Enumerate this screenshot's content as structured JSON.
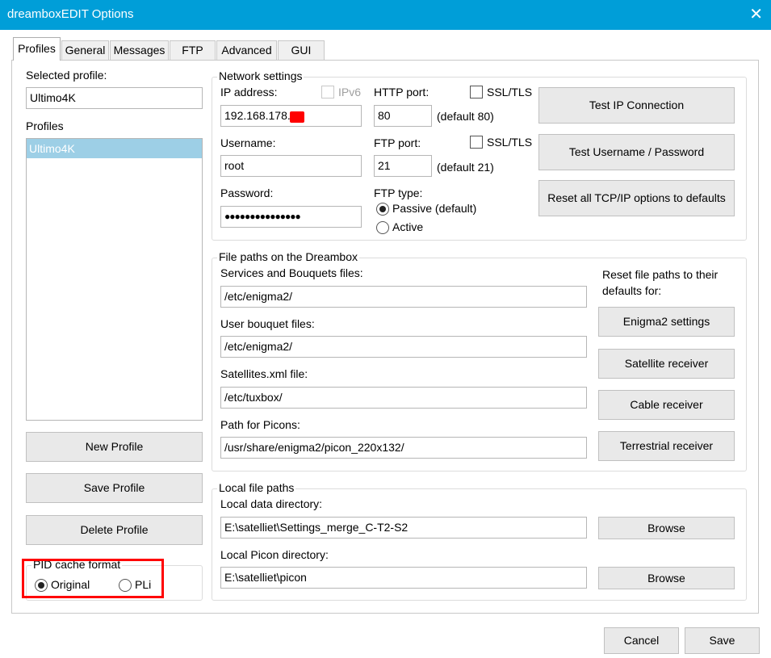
{
  "window": {
    "title": "dreamboxEDIT Options",
    "close_glyph": "✕"
  },
  "tabs": [
    {
      "label": "Profiles",
      "active": true
    },
    {
      "label": "General"
    },
    {
      "label": "Messages"
    },
    {
      "label": "FTP"
    },
    {
      "label": "Advanced"
    },
    {
      "label": "GUI"
    }
  ],
  "profiles": {
    "selected_label": "Selected profile:",
    "selected_value": "Ultimo4K",
    "list_label": "Profiles",
    "items": [
      "Ultimo4K"
    ],
    "new_button": "New Profile",
    "save_button": "Save Profile",
    "delete_button": "Delete Profile"
  },
  "pid_cache": {
    "title": "PID cache format",
    "options": [
      {
        "label": "Original",
        "selected": true
      },
      {
        "label": "PLi",
        "selected": false
      }
    ]
  },
  "network": {
    "title": "Network settings",
    "ip_label": "IP address:",
    "ip_value": "192.168.178.",
    "ipv6_label": "IPv6",
    "username_label": "Username:",
    "username_value": "root",
    "password_label": "Password:",
    "password_value": "●●●●●●●●●●●●●●●",
    "http_port_label": "HTTP port:",
    "http_port_value": "80",
    "http_port_default": "(default 80)",
    "ftp_port_label": "FTP port:",
    "ftp_port_value": "21",
    "ftp_port_default": "(default 21)",
    "ssl_label": "SSL/TLS",
    "ftp_type_label": "FTP type:",
    "ftp_type_options": [
      {
        "label": "Passive (default)",
        "selected": true
      },
      {
        "label": "Active",
        "selected": false
      }
    ],
    "test_ip_button": "Test IP Connection",
    "test_user_button": "Test Username / Password",
    "reset_button": "Reset all TCP/IP options to defaults"
  },
  "file_paths": {
    "title": "File paths on the Dreambox",
    "services_label": "Services and Bouquets files:",
    "services_value": "/etc/enigma2/",
    "user_bouquet_label": "User bouquet files:",
    "user_bouquet_value": "/etc/enigma2/",
    "satellites_label": "Satellites.xml file:",
    "satellites_value": "/etc/tuxbox/",
    "picons_label": "Path for Picons:",
    "picons_value": "/usr/share/enigma2/picon_220x132/",
    "reset_label": "Reset file paths to their defaults for:",
    "enigma2_button": "Enigma2 settings",
    "satellite_button": "Satellite receiver",
    "cable_button": "Cable receiver",
    "terrestrial_button": "Terrestrial receiver"
  },
  "local_paths": {
    "title": "Local file paths",
    "data_dir_label": "Local data directory:",
    "data_dir_value": "E:\\satelliet\\Settings_merge_C-T2-S2",
    "picon_dir_label": "Local Picon directory:",
    "picon_dir_value": "E:\\satelliet\\picon",
    "browse_button": "Browse"
  },
  "footer": {
    "cancel_button": "Cancel",
    "save_button": "Save"
  },
  "colors": {
    "titlebar": "#009ed8",
    "selection": "#9dcfe6",
    "highlight": "#ff0000"
  }
}
